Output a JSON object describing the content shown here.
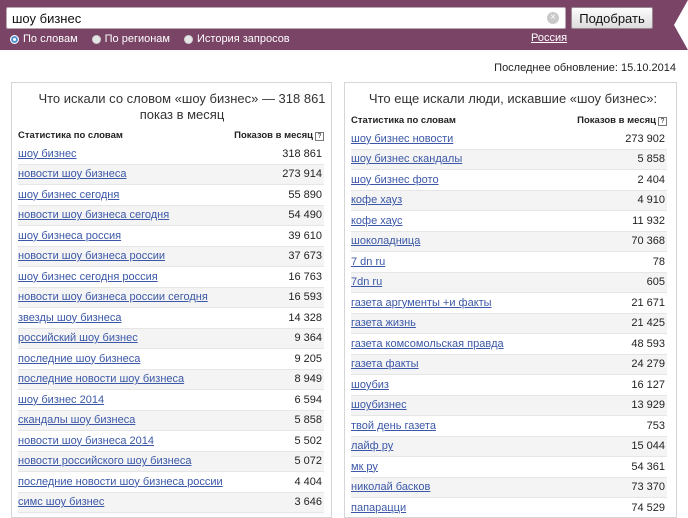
{
  "search": {
    "query": "шоу бизнес",
    "clear_label": "×",
    "button_label": "Подобрать"
  },
  "modes": [
    {
      "label": "По словам",
      "selected": true
    },
    {
      "label": "По регионам",
      "selected": false
    },
    {
      "label": "История запросов",
      "selected": false
    }
  ],
  "region": "Россия",
  "updated": "Последнее обновление: 15.10.2014",
  "left": {
    "title": "Что искали со словом «шоу бизнес» — 318 861 показ в месяц",
    "col_words": "Статистика по словам",
    "col_shows": "Показов в месяц",
    "help": "?",
    "rows": [
      {
        "word": "шоу бизнес",
        "count": "318 861"
      },
      {
        "word": "новости шоу бизнеса",
        "count": "273 914"
      },
      {
        "word": "шоу бизнес сегодня",
        "count": "55 890"
      },
      {
        "word": "новости шоу бизнеса сегодня",
        "count": "54 490"
      },
      {
        "word": "шоу бизнеса россия",
        "count": "39 610"
      },
      {
        "word": "новости шоу бизнеса россии",
        "count": "37 673"
      },
      {
        "word": "шоу бизнес сегодня россия",
        "count": "16 763"
      },
      {
        "word": "новости шоу бизнеса россии сегодня",
        "count": "16 593"
      },
      {
        "word": "звезды шоу бизнеса",
        "count": "14 328"
      },
      {
        "word": "российский шоу бизнес",
        "count": "9 364"
      },
      {
        "word": "последние шоу бизнеса",
        "count": "9 205"
      },
      {
        "word": "последние новости шоу бизнеса",
        "count": "8 949"
      },
      {
        "word": "шоу бизнес 2014",
        "count": "6 594"
      },
      {
        "word": "скандалы шоу бизнеса",
        "count": "5 858"
      },
      {
        "word": "новости шоу бизнеса 2014",
        "count": "5 502"
      },
      {
        "word": "новости российского шоу бизнеса",
        "count": "5 072"
      },
      {
        "word": "последние новости шоу бизнеса россии",
        "count": "4 404"
      },
      {
        "word": "симс шоу бизнес",
        "count": "3 646"
      }
    ]
  },
  "right": {
    "title": "Что еще искали люди, искавшие «шоу бизнес»:",
    "col_words": "Статистика по словам",
    "col_shows": "Показов в месяц",
    "help": "?",
    "rows": [
      {
        "word": "шоу бизнес новости",
        "count": "273 902"
      },
      {
        "word": "шоу бизнес скандалы",
        "count": "5 858"
      },
      {
        "word": "шоу бизнес фото",
        "count": "2 404"
      },
      {
        "word": "кофе хауз",
        "count": "4 910"
      },
      {
        "word": "кофе хаус",
        "count": "11 932"
      },
      {
        "word": "шоколадница",
        "count": "70 368"
      },
      {
        "word": "7 dn ru",
        "count": "78"
      },
      {
        "word": "7dn ru",
        "count": "605"
      },
      {
        "word": "газета аргументы +и факты",
        "count": "21 671"
      },
      {
        "word": "газета жизнь",
        "count": "21 425"
      },
      {
        "word": "газета комсомольская правда",
        "count": "48 593"
      },
      {
        "word": "газета факты",
        "count": "24 279"
      },
      {
        "word": "шоубиз",
        "count": "16 127"
      },
      {
        "word": "шоубизнес",
        "count": "13 929"
      },
      {
        "word": "твой день газета",
        "count": "753"
      },
      {
        "word": "лайф ру",
        "count": "15 044"
      },
      {
        "word": "мк ру",
        "count": "54 361"
      },
      {
        "word": "николай басков",
        "count": "73 370"
      },
      {
        "word": "папарацци",
        "count": "74 529"
      }
    ]
  }
}
